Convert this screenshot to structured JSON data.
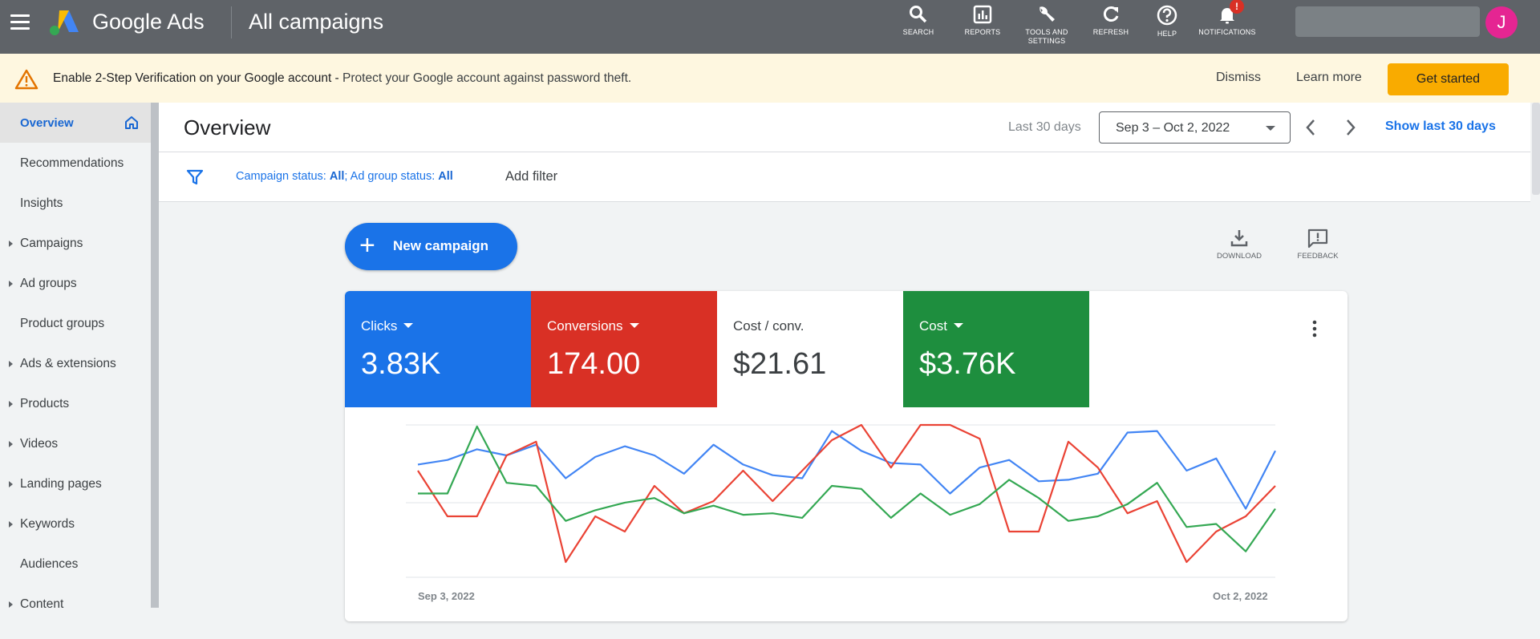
{
  "topbar": {
    "brand": "Google Ads",
    "page": "All campaigns",
    "actions": [
      {
        "label": "SEARCH",
        "icon": "search-icon"
      },
      {
        "label": "REPORTS",
        "icon": "reports-icon"
      },
      {
        "label": "TOOLS AND SETTINGS",
        "icon": "wrench-icon"
      },
      {
        "label": "REFRESH",
        "icon": "refresh-icon"
      },
      {
        "label": "HELP",
        "icon": "help-icon"
      },
      {
        "label": "NOTIFICATIONS",
        "icon": "bell-icon",
        "badge": "!"
      }
    ],
    "avatar_initial": "J",
    "avatar_color": "#e52592"
  },
  "alert": {
    "title": "Enable 2-Step Verification on your Google account - ",
    "text": "Protect your Google account against password theft.",
    "dismiss": "Dismiss",
    "learn_more": "Learn more",
    "get_started": "Get started"
  },
  "sidebar": {
    "items": [
      {
        "label": "Overview",
        "active": true,
        "expandable": false
      },
      {
        "label": "Recommendations",
        "expandable": false
      },
      {
        "label": "Insights",
        "expandable": false
      },
      {
        "label": "Campaigns",
        "expandable": true
      },
      {
        "label": "Ad groups",
        "expandable": true
      },
      {
        "label": "Product groups",
        "expandable": false
      },
      {
        "label": "Ads & extensions",
        "expandable": true
      },
      {
        "label": "Products",
        "expandable": true
      },
      {
        "label": "Videos",
        "expandable": true
      },
      {
        "label": "Landing pages",
        "expandable": true
      },
      {
        "label": "Keywords",
        "expandable": true
      },
      {
        "label": "Audiences",
        "expandable": false
      },
      {
        "label": "Content",
        "expandable": true
      }
    ]
  },
  "overview": {
    "title": "Overview",
    "range_label": "Last 30 days",
    "date_range": "Sep 3 – Oct 2, 2022",
    "show_last": "Show last 30 days"
  },
  "filter": {
    "campaign_status_label": "Campaign status: ",
    "campaign_status_value": "All",
    "sep": "; ",
    "ad_group_status_label": "Ad group status: ",
    "ad_group_status_value": "All",
    "add_filter": "Add filter"
  },
  "actions": {
    "new_campaign": "New campaign",
    "download": "DOWNLOAD",
    "feedback": "FEEDBACK"
  },
  "metrics": [
    {
      "label": "Clicks",
      "value": "3.83K",
      "color": "#1a73e8"
    },
    {
      "label": "Conversions",
      "value": "174.00",
      "color": "#d93025"
    },
    {
      "label": "Cost / conv.",
      "value": "$21.61",
      "color": "#ffffff"
    },
    {
      "label": "Cost",
      "value": "$3.76K",
      "color": "#1e8e3e"
    }
  ],
  "chart_data": {
    "type": "line",
    "x_start_label": "Sep 3, 2022",
    "x_end_label": "Oct 2, 2022",
    "grid": true,
    "series": [
      {
        "name": "Clicks",
        "color": "#4285f4",
        "values": [
          0.74,
          0.77,
          0.84,
          0.8,
          0.87,
          0.65,
          0.79,
          0.86,
          0.8,
          0.68,
          0.87,
          0.74,
          0.67,
          0.65,
          0.96,
          0.83,
          0.75,
          0.74,
          0.55,
          0.72,
          0.77,
          0.63,
          0.64,
          0.68,
          0.95,
          0.96,
          0.7,
          0.78,
          0.45,
          0.83
        ]
      },
      {
        "name": "Conversions",
        "color": "#ea4335",
        "values": [
          0.7,
          0.4,
          0.4,
          0.8,
          0.89,
          0.1,
          0.4,
          0.3,
          0.6,
          0.42,
          0.5,
          0.7,
          0.5,
          0.7,
          0.9,
          1.0,
          0.72,
          1.0,
          1.0,
          0.91,
          0.3,
          0.3,
          0.89,
          0.72,
          0.42,
          0.5,
          0.1,
          0.3,
          0.4,
          0.6
        ]
      },
      {
        "name": "Cost",
        "color": "#34a853",
        "values": [
          0.55,
          0.55,
          0.99,
          0.62,
          0.6,
          0.37,
          0.44,
          0.49,
          0.52,
          0.42,
          0.47,
          0.41,
          0.42,
          0.39,
          0.6,
          0.58,
          0.39,
          0.55,
          0.41,
          0.48,
          0.64,
          0.52,
          0.37,
          0.4,
          0.48,
          0.62,
          0.33,
          0.35,
          0.17,
          0.45
        ]
      }
    ]
  }
}
